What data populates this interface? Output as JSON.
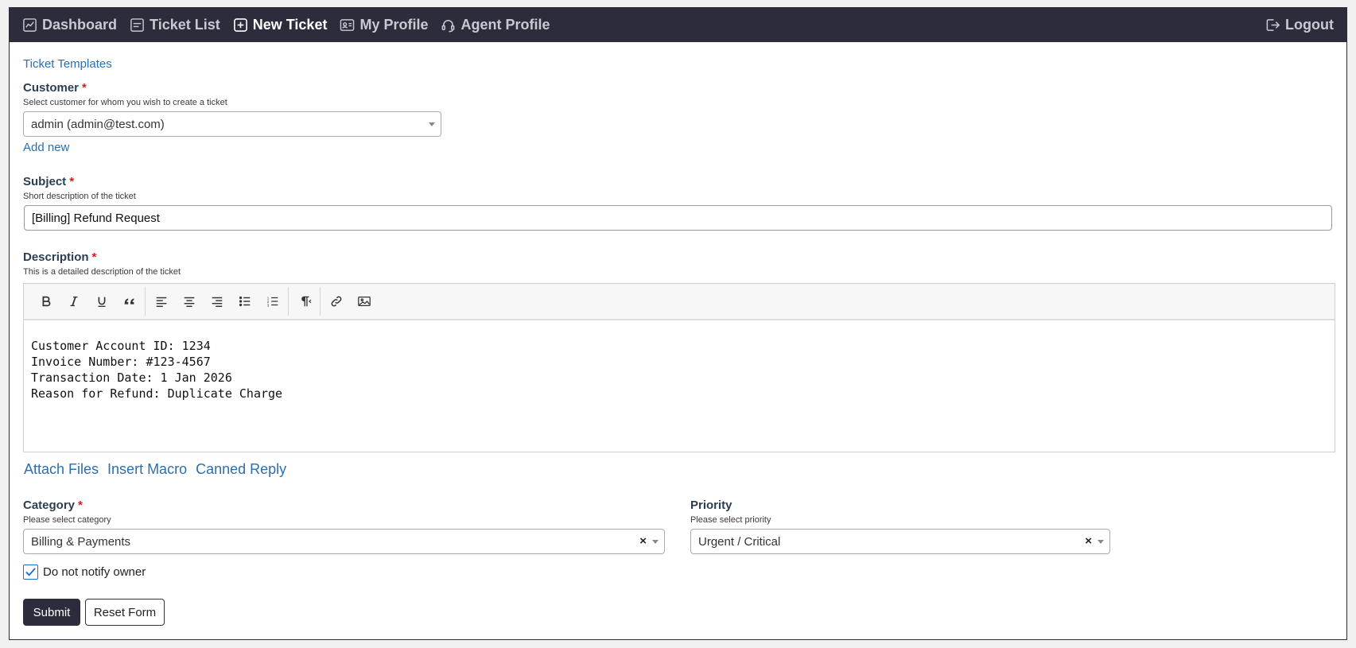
{
  "nav": {
    "items": [
      {
        "label": "Dashboard",
        "icon": "chart-line-icon"
      },
      {
        "label": "Ticket List",
        "icon": "list-icon"
      },
      {
        "label": "New Ticket",
        "icon": "plus-square-icon"
      },
      {
        "label": "My Profile",
        "icon": "id-card-icon"
      },
      {
        "label": "Agent Profile",
        "icon": "headset-icon"
      }
    ],
    "logout": "Logout",
    "active": "New Ticket"
  },
  "form": {
    "templates_link": "Ticket Templates",
    "customer": {
      "label": "Customer",
      "hint": "Select customer for whom you wish to create a ticket",
      "value": "admin (admin@test.com)",
      "add_new": "Add new"
    },
    "subject": {
      "label": "Subject",
      "hint": "Short description of the ticket",
      "value": "[Billing] Refund Request"
    },
    "description": {
      "label": "Description",
      "hint": "This is a detailed description of the ticket",
      "lines": [
        "Customer Account ID: 1234",
        "Invoice Number: #123-4567",
        "Transaction Date: 1 Jan 2026",
        "Reason for Refund: Duplicate Charge"
      ]
    },
    "editor_links": [
      "Attach Files",
      "Insert Macro",
      "Canned Reply"
    ],
    "category": {
      "label": "Category",
      "hint": "Please select category",
      "value": "Billing & Payments"
    },
    "priority": {
      "label": "Priority",
      "hint": "Please select priority",
      "value": "Urgent / Critical"
    },
    "notify_owner": {
      "label": "Do not notify owner",
      "checked": true
    },
    "submit": "Submit",
    "reset": "Reset Form",
    "required_mark": "*"
  },
  "colors": {
    "topbar": "#2c2c3c",
    "link": "#2a6fb0",
    "required": "#e01818"
  }
}
